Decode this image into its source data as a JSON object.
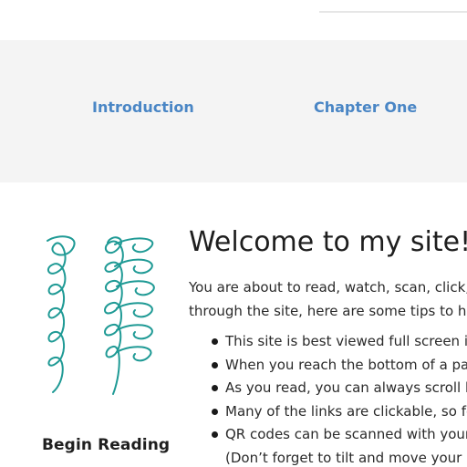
{
  "nav": {
    "items": [
      {
        "label": "Introduction"
      },
      {
        "label": "Chapter One"
      }
    ]
  },
  "sidebar": {
    "begin_reading": "Begin Reading",
    "illustration_color": "#1f9a95"
  },
  "main": {
    "title": "Welcome to my site!",
    "intro_lines": [
      "You are about to read, watch, scan, click,",
      "through the site, here are some tips to he"
    ],
    "tips": [
      "This site is best viewed full screen in",
      "When you reach the bottom of a pa",
      "As you read, you can always scroll b",
      "Many of the links are clickable, so fe",
      "QR codes can be scanned with your",
      "(Don’t forget to tilt and move your p"
    ]
  },
  "colors": {
    "nav_link": "#4a86c5",
    "nav_band": "#f4f4f4",
    "text": "#222222"
  }
}
